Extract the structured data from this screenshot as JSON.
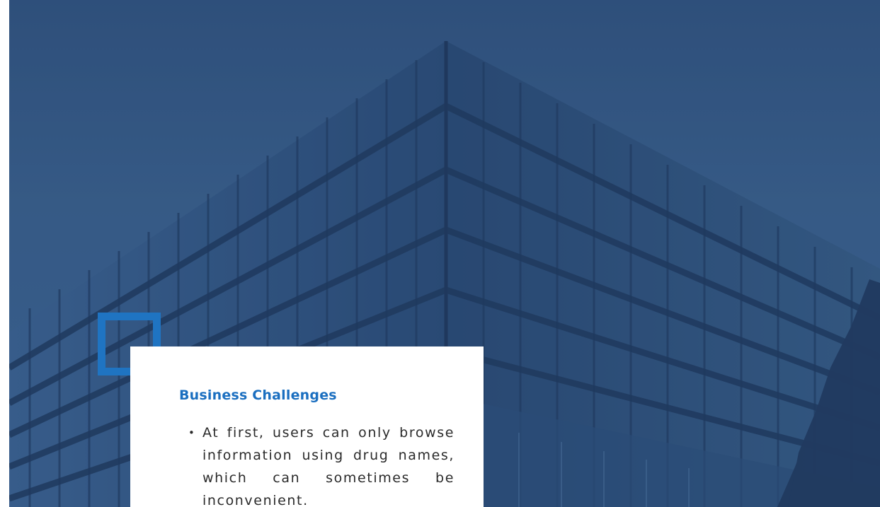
{
  "hero": {
    "image": "office-building-photo",
    "overlay_color": "#2f5382"
  },
  "accent": {
    "color": "#1f74c2"
  },
  "card": {
    "title": "Business Challenges",
    "title_color": "#1b6fc0",
    "items": [
      "At first, users can only browse information using drug names, which can sometimes be inconvenient."
    ]
  }
}
